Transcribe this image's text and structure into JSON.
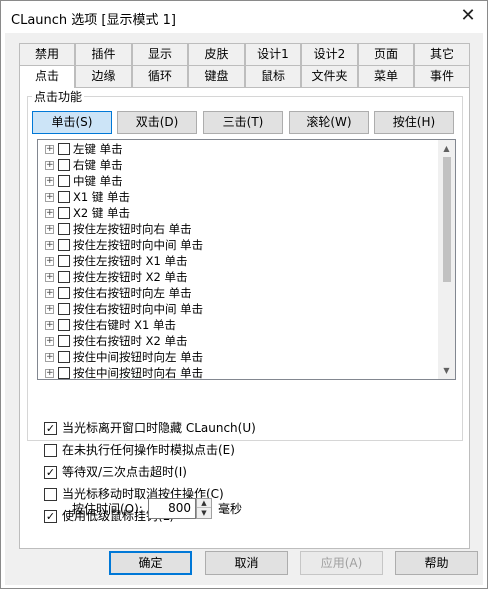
{
  "window": {
    "title": "CLaunch 选项 [显示模式 1]",
    "close_glyph": "✕"
  },
  "tabs": {
    "row1": [
      "禁用",
      "插件",
      "显示",
      "皮肤",
      "设计1",
      "设计2",
      "页面",
      "其它"
    ],
    "row2": [
      "点击",
      "边缘",
      "循环",
      "键盘",
      "鼠标",
      "文件夹",
      "菜单",
      "事件"
    ],
    "active": "点击"
  },
  "click_group": {
    "label": "点击功能",
    "modes": [
      "单击(S)",
      "双击(D)",
      "三击(T)",
      "滚轮(W)",
      "按住(H)"
    ],
    "active_mode": "单击(S)",
    "tree_items": [
      "左键 单击",
      "右键 单击",
      "中键 单击",
      "X1 键 单击",
      "X2 键 单击",
      "按住左按钮时向右 单击",
      "按住左按钮时向中间 单击",
      "按住左按钮时 X1 单击",
      "按住左按钮时 X2 单击",
      "按住右按钮时向左 单击",
      "按住右按钮时向中间 单击",
      "按住右键时 X1 单击",
      "按住右按钮时 X2 单击",
      "按住中间按钮时向左 单击",
      "按住中间按钮时向右 单击"
    ]
  },
  "options": [
    {
      "label": "当光标离开窗口时隐藏 CLaunch(U)",
      "checked": true
    },
    {
      "label": "在未执行任何操作时模拟点击(E)",
      "checked": false
    },
    {
      "label": "等待双/三次点击超时(I)",
      "checked": true
    },
    {
      "label": "当光标移动时取消按住操作(C)",
      "checked": false
    },
    {
      "label": "使用低级鼠标挂钩(L)",
      "checked": true
    }
  ],
  "hold_time": {
    "label": "按住时间(O):",
    "value": "800",
    "unit": "毫秒"
  },
  "footer": {
    "ok": "确定",
    "cancel": "取消",
    "apply": "应用(A)",
    "help": "帮助"
  },
  "colors": {
    "active_tab_bg": "#ffffff",
    "active_mode_bg": "#cce4f7",
    "accent": "#0078d7"
  }
}
